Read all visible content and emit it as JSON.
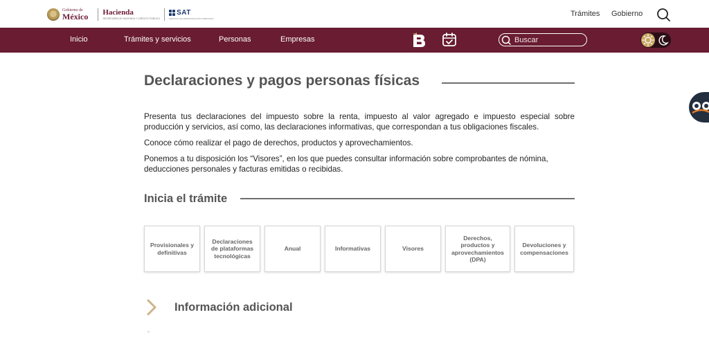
{
  "header": {
    "logo_gob_small": "Gobierno de",
    "logo_gob_big": "México",
    "logo_hacienda": "Hacienda",
    "logo_hacienda_sub": "SECRETARÍA DE HACIENDA Y CRÉDITO PÚBLICO",
    "logo_sat": "SAT",
    "logo_sat_sub": "SERVICIO DE ADMINISTRACIÓN TRIBUTARIA",
    "links": [
      "Trámites",
      "Gobierno"
    ],
    "search_icon": "search-icon"
  },
  "nav": {
    "items": [
      "Inicio",
      "Trámites y servicios",
      "Personas",
      "Empresas"
    ],
    "search_placeholder": "Buscar",
    "icons": [
      "b-brand-icon",
      "calendar-check-icon",
      "search-icon",
      "sun-icon",
      "moon-icon"
    ],
    "bar_color": "#691c32"
  },
  "main": {
    "title": "Declaraciones y pagos personas físicas",
    "paragraphs": [
      "Presenta tus declaraciones del impuesto sobre la renta, impuesto al valor agregado e impuesto especial sobre producción y servicios, así como, las declaraciones informativas, que correspondan a tus obligaciones fiscales.",
      "Conoce cómo realizar el pago de derechos, productos y aprovechamientos.",
      "Ponemos a tu disposición los “Visores”, en los que puedes consultar información sobre comprobantes de nómina, deducciones personales y facturas emitidas o recibidas."
    ],
    "section_title": "Inicia el trámite",
    "cards": [
      "Provisionales y definitivas",
      "Declaraciones de plataformas tecnológicas",
      "Anual",
      "Informativas",
      "Visores",
      "Derechos, productos y aprovechamientos (DPA)",
      "Devoluciones y compensaciones"
    ],
    "info_title": "Información adicional",
    "info_icon": "chevron-right-icon"
  },
  "side_widget": {
    "icon": "accessibility-eyes-icon"
  }
}
